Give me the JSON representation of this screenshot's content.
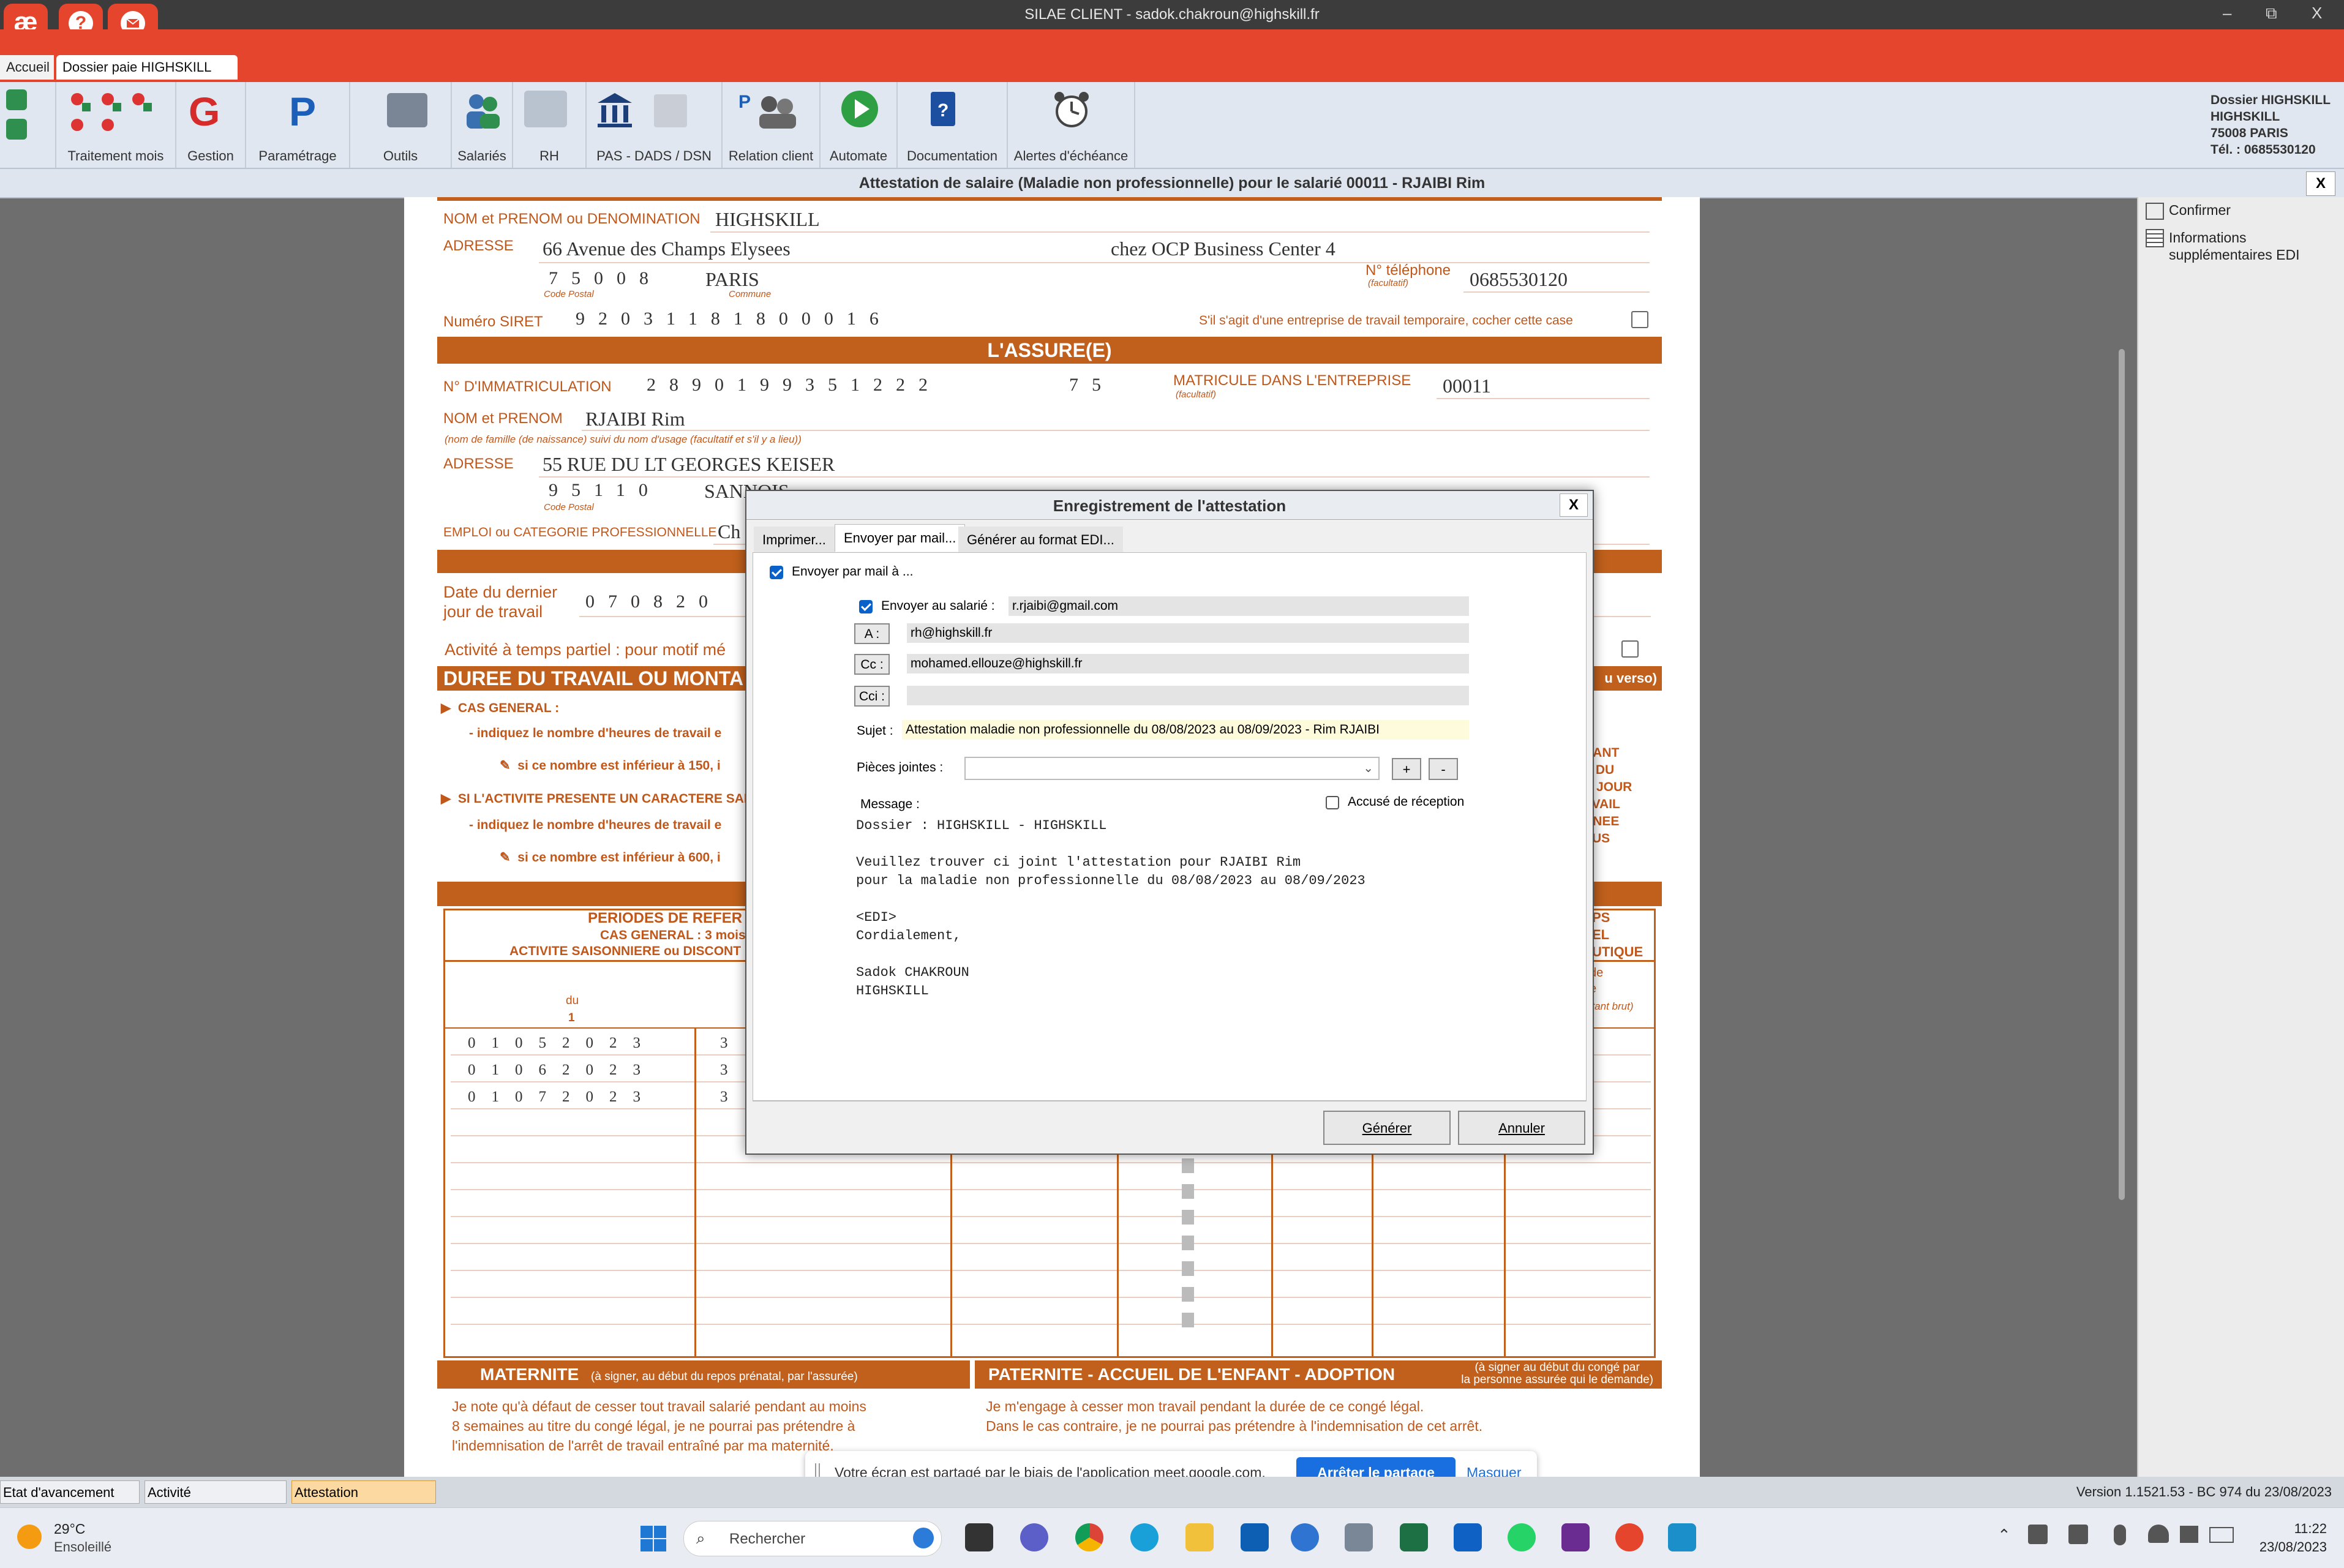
{
  "window": {
    "title": "SILAE CLIENT - sadok.chakroun@highskill.fr",
    "logo": "æ",
    "help": "?",
    "minimize": "–",
    "maximize": "⧉",
    "close": "X"
  },
  "tabs": [
    "Accueil",
    "Dossier paie HIGHSKILL"
  ],
  "ribbon": {
    "groups": [
      "Traitement mois",
      "Gestion",
      "Paramétrage",
      "Outils",
      "Salariés",
      "RH",
      "PAS - DADS / DSN",
      "Relation client",
      "Automate",
      "Documentation",
      "Alertes d'échéance"
    ]
  },
  "company": {
    "line1": "Dossier HIGHSKILL",
    "line2": "HIGHSKILL",
    "line3": "75008 PARIS",
    "line4": "Tél. : 0685530120"
  },
  "document_title": "Attestation de salaire (Maladie non professionnelle) pour le salarié 00011 - RJAIBI Rim",
  "document_close": "X",
  "form": {
    "employer": {
      "name_label": "NOM et PRENOM ou DENOMINATION",
      "name": "HIGHSKILL",
      "address_label": "ADRESSE",
      "address": "66 Avenue des Champs Elysees",
      "address2": "chez OCP Business Center 4",
      "postcode": "75008",
      "city": "PARIS",
      "postcode_hint": "Code Postal",
      "city_hint": "Commune",
      "phone_label": "N° téléphone",
      "phone_hint": "(facultatif)",
      "phone": "0685530120",
      "siret_label": "Numéro SIRET",
      "siret": "92031181800016",
      "temp_label": "S'il s'agit d'une entreprise de travail temporaire, cocher cette case"
    },
    "insured_header": "L'ASSURE(E)",
    "insured": {
      "immat_label": "N° D'IMMATRICULATION",
      "immat": "2890199351222",
      "immat_key": "75",
      "matricule_label": "MATRICULE DANS L'ENTREPRISE",
      "matricule_hint": "(facultatif)",
      "matricule": "00011",
      "name_label": "NOM et PRENOM",
      "name": "RJAIBI Rim",
      "name_hint": "(nom de famille (de naissance) suivi du nom d'usage (facultatif et s'il y a lieu))",
      "address_label": "ADRESSE",
      "address": "55  RUE DU LT GEORGES KEISER",
      "postcode": "95110",
      "city": "SANNOIS",
      "postcode_hint": "Code Postal",
      "job_label": "EMPLOI ou CATEGORIE PROFESSIONNELLE",
      "job": "Ch"
    },
    "last_day_label1": "Date du dernier",
    "last_day_label2": "jour de travail",
    "last_day": "070820",
    "partial_label": "Activité à temps partiel : pour motif mé",
    "duration_header": "DUREE DU TRAVAIL OU MONTA",
    "duration_header_right": "u verso)",
    "general_case": "CAS GENERAL :",
    "general_line": "- indiquez le nombre d'heures de travail e",
    "general_sub": "si ce nombre est inférieur à 150, i",
    "seasonal_case": "SI L'ACTIVITE PRESENTE UN CARACTERE SAI",
    "seasonal_line": "- indiquez le nombre d'heures de travail e",
    "seasonal_sub": "si ce nombre est inférieur à 600, i",
    "right_fragments": [
      "DANT",
      "E DU",
      "R JOUR",
      "AVAIL",
      "NNEE",
      "SUS"
    ],
    "periods_header": "PERIODES DE REFER",
    "periods_sub1": "CAS GENERAL : 3 mois",
    "periods_sub2": "ACTIVITE SAISONNIERE ou DISCONT",
    "periods_right": [
      "PS",
      "EL",
      "UTIQUE"
    ],
    "periods_right2": [
      "de",
      "e",
      "ntant brut)"
    ],
    "du_label": "du",
    "col_index": "1",
    "periods": [
      {
        "from": "01052023",
        "to": "3"
      },
      {
        "from": "01062023",
        "to": "3"
      },
      {
        "from": "01072023",
        "to": "3"
      }
    ],
    "maternite_title": "MATERNITE",
    "maternite_hint": "(à signer, au début du repos  prénatal, par l'assurée)",
    "maternite_text1": "Je note qu'à défaut de cesser tout travail salarié pendant au moins",
    "maternite_text2": "8 semaines au titre du congé légal, je ne pourrai pas prétendre à",
    "maternite_text3": "l'indemnisation de l'arrêt de travail entraîné par ma maternité.",
    "paternite_title": "PATERNITE - ACCUEIL DE L'ENFANT - ADOPTION",
    "paternite_hint1": "(à signer au début du congé par",
    "paternite_hint2": "la personne assurée qui le demande)",
    "paternite_text1": "Je m'engage à cesser  mon travail pendant la durée de ce congé légal.",
    "paternite_text2": "Dans le cas contraire, je ne pourrai pas prétendre à l'indemnisation de cet arrêt."
  },
  "side_panel": {
    "confirm": "Confirmer",
    "edi1": "Informations",
    "edi2": "supplémentaires EDI"
  },
  "dialog": {
    "title": "Enregistrement de l'attestation",
    "close": "X",
    "tabs": [
      "Imprimer...",
      "Envoyer par mail...",
      "Générer au format EDI..."
    ],
    "send_mail_label": "Envoyer par mail à ...",
    "send_employee_label": "Envoyer au salarié :",
    "employee_email": "r.rjaibi@gmail.com",
    "to_label": "A :",
    "to": "rh@highskill.fr",
    "cc_label": "Cc :",
    "cc": "mohamed.ellouze@highskill.fr",
    "bcc_label": "Cci :",
    "bcc": "",
    "subject_label": "Sujet :",
    "subject": "Attestation maladie non professionnelle du 08/08/2023 au 08/09/2023 - Rim RJAIBI",
    "attachments_label": "Pièces jointes :",
    "add": "+",
    "remove": "-",
    "message_label": "Message :",
    "receipt_label": "Accusé de réception",
    "message": "Dossier : HIGHSKILL - HIGHSKILL\n\nVeuillez trouver ci joint l'attestation pour RJAIBI Rim\npour la maladie non professionnelle du 08/08/2023 au 08/09/2023\n\n<EDI>\nCordialement,\n\nSadok CHAKROUN\nHIGHSKILL",
    "generate": "Générer",
    "cancel": "Annuler"
  },
  "share_banner": {
    "text": "Votre écran est partagé par le biais de l'application meet.google.com.",
    "stop": "Arrêter le partage",
    "hide": "Masquer"
  },
  "status_tabs": [
    "Etat d'avancement",
    "Activité",
    "Attestation"
  ],
  "version": "Version 1.1521.53 - BC 974 du 23/08/2023",
  "taskbar": {
    "weather_temp": "29°C",
    "weather_desc": "Ensoleillé",
    "search": "Rechercher",
    "time": "11:22",
    "date": "23/08/2023"
  },
  "colors": {
    "accent": "#e4452c",
    "form_orange": "#c0601c",
    "link_blue": "#1a6fe0"
  }
}
